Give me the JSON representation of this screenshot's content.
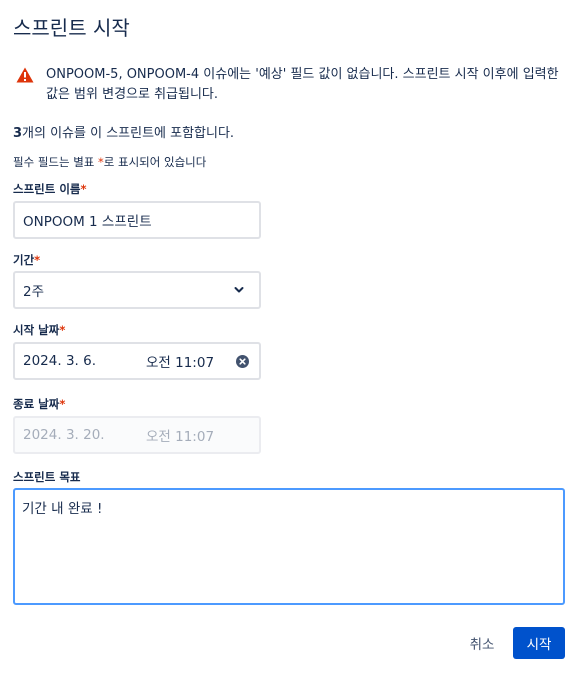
{
  "dialog": {
    "title": "스프린트 시작"
  },
  "warning": {
    "icon": "warning-triangle-icon",
    "message": "ONPOOM-5, ONPOOM-4 이슈에는 '예상' 필드 값이 없습니다. 스프린트 시작 이후에 입력한 값은 범위 변경으로 취급됩니다.",
    "color": "#de350b"
  },
  "summary": {
    "count": "3",
    "text": "개의 이슈를 이 스프린트에 포함합니다."
  },
  "required_note": {
    "text": "필수 필드는 별표 ",
    "star": "*",
    "suffix": "로 표시되어 있습니다"
  },
  "form": {
    "sprint_name": {
      "label": "스프린트 이름",
      "required": "*",
      "value": "ONPOOM 1 스프린트"
    },
    "duration": {
      "label": "기간",
      "required": "*",
      "value": "2주"
    },
    "start_date": {
      "label": "시작 날짜",
      "required": "*",
      "date": "2024. 3. 6.",
      "time": "오전 11:07"
    },
    "end_date": {
      "label": "종료 날짜",
      "required": "*",
      "date": "2024. 3. 20.",
      "time": "오전 11:07"
    },
    "goal": {
      "label": "스프린트 목표",
      "value": "기간 내 완료 !"
    }
  },
  "footer": {
    "cancel_label": "취소",
    "start_label": "시작",
    "primary_color": "#0052cc"
  }
}
